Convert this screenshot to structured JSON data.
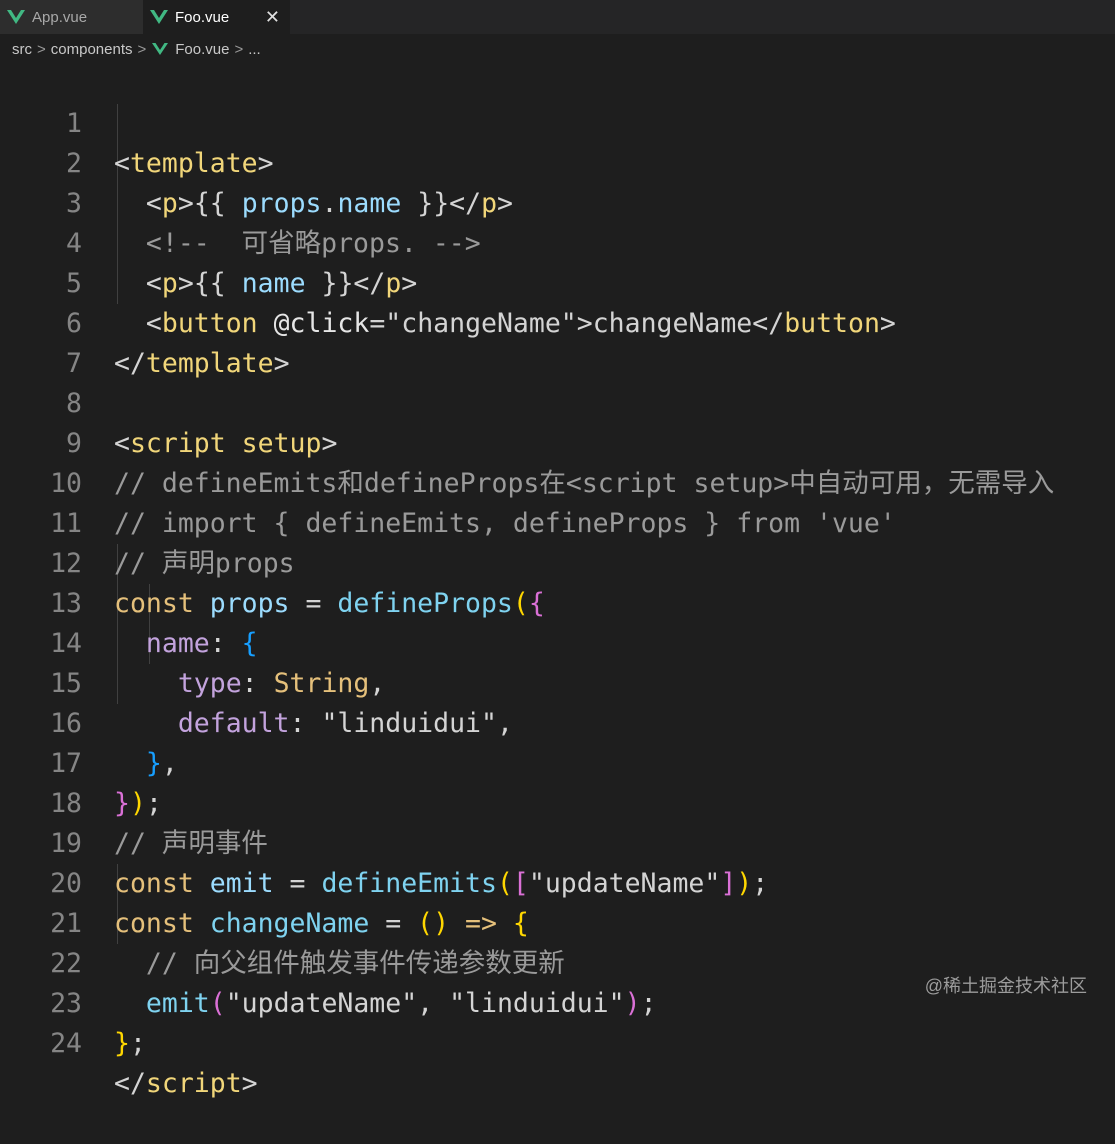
{
  "tabs": [
    {
      "label": "App.vue",
      "active": false
    },
    {
      "label": "Foo.vue",
      "active": true
    }
  ],
  "tab_close_glyph": "✕",
  "breadcrumb": {
    "items": [
      "src",
      "components",
      "Foo.vue",
      "..."
    ],
    "separator": ">"
  },
  "line_numbers": [
    "1",
    "2",
    "3",
    "4",
    "5",
    "6",
    "7",
    "8",
    "9",
    "10",
    "11",
    "12",
    "13",
    "14",
    "15",
    "16",
    "17",
    "18",
    "19",
    "20",
    "21",
    "22",
    "23",
    "24"
  ],
  "code": {
    "l1": {
      "open": "<",
      "tag": "template",
      "close": ">"
    },
    "l2": {
      "open": "<",
      "tag": "p",
      "close": ">",
      "mustache_open": "{{ ",
      "obj": "props",
      "dot": ".",
      "field": "name",
      "mustache_close": " }}",
      "end_open": "</",
      "end_tag": "p",
      "end_close": ">"
    },
    "l3": {
      "comment": "<!--  可省略props. -->"
    },
    "l4": {
      "open": "<",
      "tag": "p",
      "close": ">",
      "mustache_open": "{{ ",
      "field": "name",
      "mustache_close": " }}",
      "end_open": "</",
      "end_tag": "p",
      "end_close": ">"
    },
    "l5": {
      "open": "<",
      "tag": "button",
      "sp": " ",
      "attr": "@click",
      "eq": "=",
      "value": "\"changeName\"",
      "close": ">",
      "text": "changeName",
      "end_open": "</",
      "end_tag": "button",
      "end_close": ">"
    },
    "l6": {
      "open": "</",
      "tag": "template",
      "close": ">"
    },
    "l8": {
      "open": "<",
      "tag": "script",
      "sp": " ",
      "attr": "setup",
      "close": ">"
    },
    "l9": {
      "comment": "// defineEmits和defineProps在<script setup>中自动可用，无需导入"
    },
    "l10": {
      "comment": "// import { defineEmits, defineProps } from 'vue'"
    },
    "l11": {
      "comment": "// 声明props"
    },
    "l12": {
      "kw": "const",
      "name": " props",
      "op": " = ",
      "fn": "defineProps",
      "p1": "(",
      "p2": "{"
    },
    "l13": {
      "key": "name",
      "colon": ": ",
      "brace": "{"
    },
    "l14": {
      "key": "type",
      "colon": ": ",
      "val": "String",
      "comma": ","
    },
    "l15": {
      "key": "default",
      "colon": ": ",
      "val": "\"linduidui\"",
      "comma": ","
    },
    "l16": {
      "brace": "}",
      "comma": ","
    },
    "l17": {
      "b1": "}",
      "b2": ")",
      "semi": ";"
    },
    "l18": {
      "comment": "// 声明事件"
    },
    "l19": {
      "kw": "const",
      "name": " emit",
      "op": " = ",
      "fn": "defineEmits",
      "p1": "(",
      "p2": "[",
      "val": "\"updateName\"",
      "p3": "]",
      "p4": ")",
      "semi": ";"
    },
    "l20": {
      "kw": "const",
      "name": " changeName",
      "op": " = ",
      "p1": "()",
      "arrow": " => ",
      "p2": "{"
    },
    "l21": {
      "comment": "// 向父组件触发事件传递参数更新"
    },
    "l22": {
      "fn": "emit",
      "p1": "(",
      "val1": "\"updateName\"",
      "comma": ", ",
      "val2": "\"linduidui\"",
      "p2": ")",
      "semi": ";"
    },
    "l23": {
      "b1": "}",
      "semi": ";"
    },
    "l24": {
      "open": "</",
      "tag": "script",
      "close": ">"
    }
  },
  "watermark": "@稀土掘金技术社区",
  "colors": {
    "background": "#1e1e1e",
    "tag": "#f1d67a",
    "comment": "#9a9a9a",
    "variable": "#9cdcfe",
    "function": "#7fd3f0",
    "keyword": "#e5c07b"
  }
}
